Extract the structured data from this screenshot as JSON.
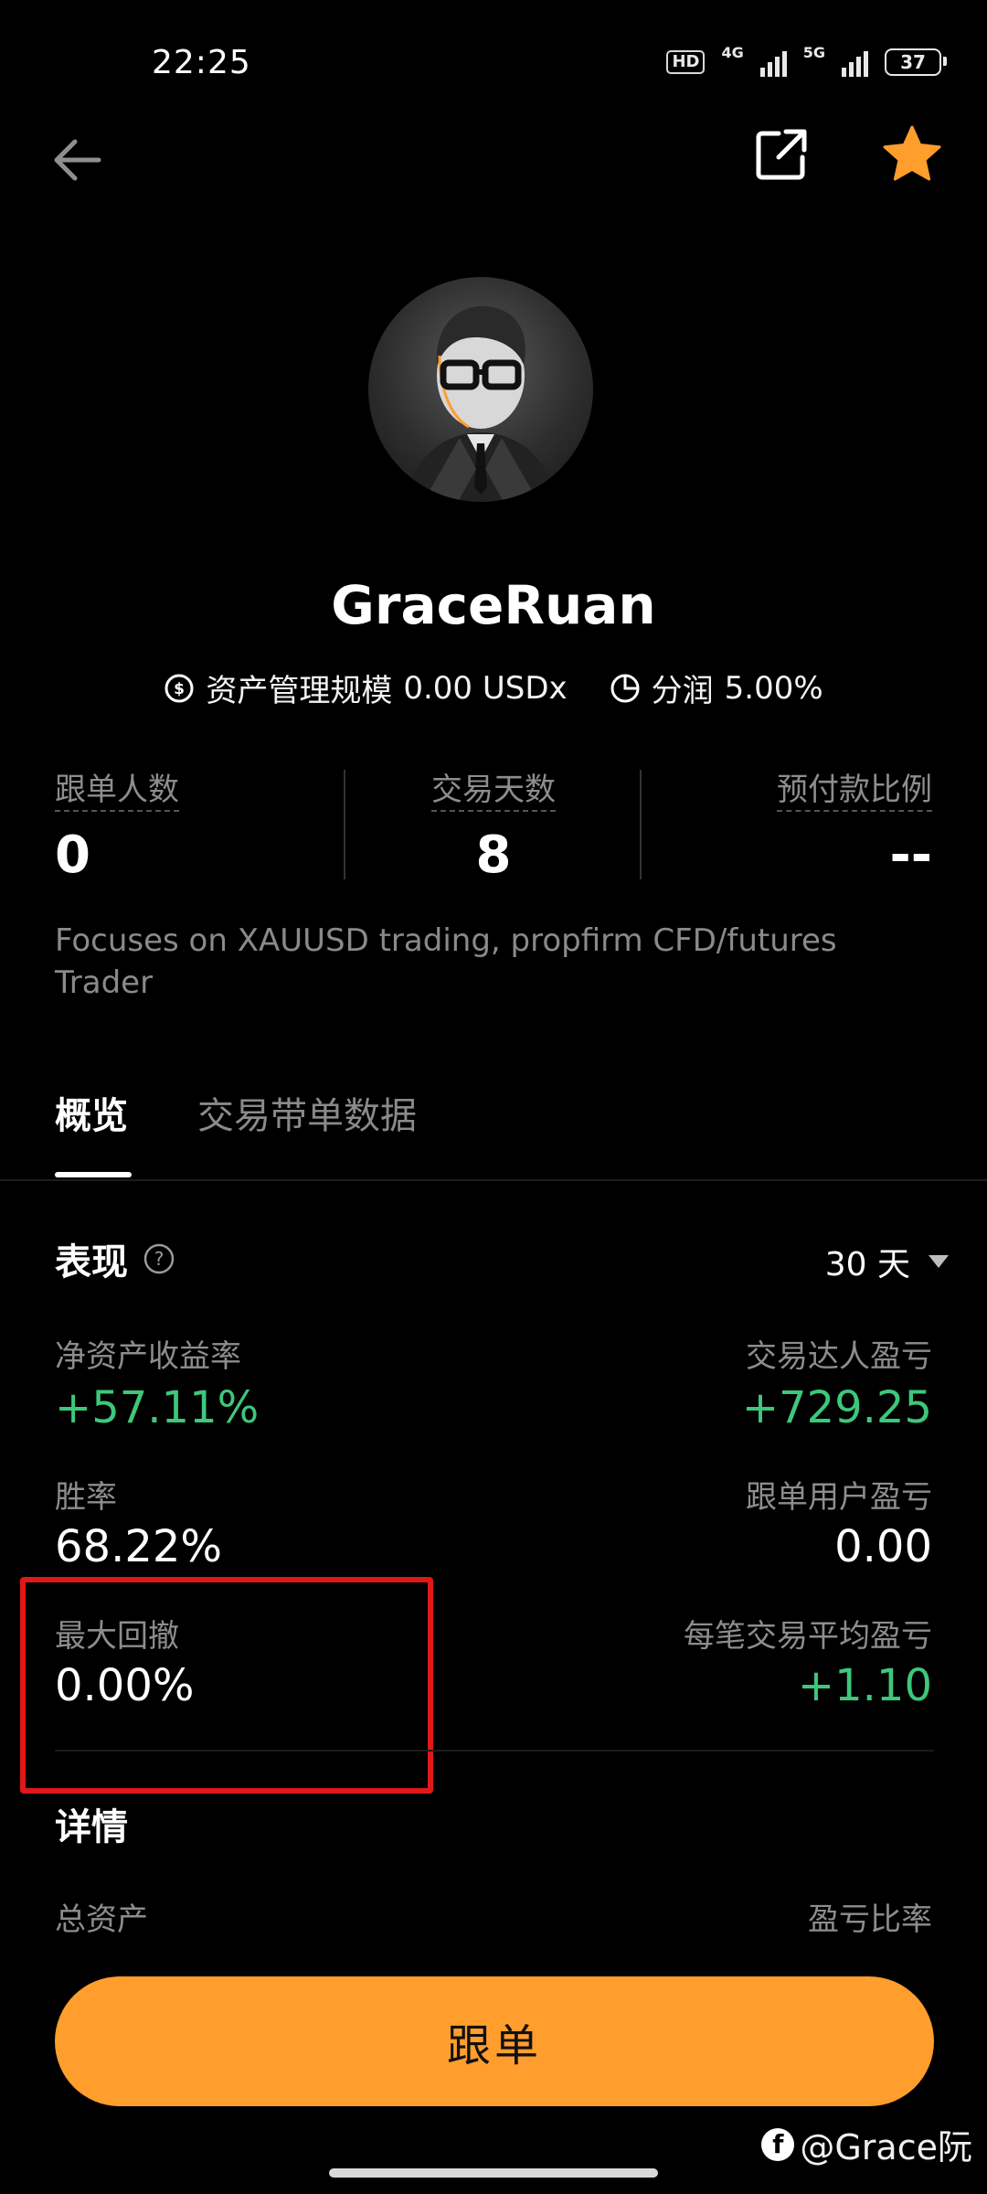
{
  "status_bar": {
    "time": "22:25",
    "network_hd": "HD",
    "net_1": "4G",
    "net_2": "5G",
    "battery": "37"
  },
  "profile": {
    "name": "GraceRuan",
    "aum_label": "资产管理规模",
    "aum_value": "0.00 USDx",
    "profit_share_label": "分润",
    "profit_share_value": "5.00%"
  },
  "stats": [
    {
      "label": "跟单人数",
      "value": "0"
    },
    {
      "label": "交易天数",
      "value": "8"
    },
    {
      "label": "预付款比例",
      "value": "--"
    }
  ],
  "description": "Focuses on XAUUSD trading, propfirm CFD/futures Trader",
  "tabs": [
    {
      "label": "概览",
      "active": true
    },
    {
      "label": "交易带单数据",
      "active": false
    }
  ],
  "performance": {
    "title": "表现",
    "period": "30 天",
    "metrics": [
      {
        "label": "净资产收益率",
        "value": "+57.11%",
        "color": "#3ec77b"
      },
      {
        "label": "交易达人盈亏",
        "value": "+729.25",
        "color": "#3ec77b"
      },
      {
        "label": "胜率",
        "value": "68.22%",
        "color": "#ffffff"
      },
      {
        "label": "跟单用户盈亏",
        "value": "0.00",
        "color": "#ffffff"
      },
      {
        "label": "最大回撤",
        "value": "0.00%",
        "color": "#ffffff"
      },
      {
        "label": "每笔交易平均盈亏",
        "value": "+1.10",
        "color": "#3ec77b"
      }
    ]
  },
  "details": {
    "title": "详情",
    "left_label": "总资产",
    "right_label": "盈亏比率"
  },
  "follow_button": "跟单",
  "watermark": "@Grace阮",
  "colors": {
    "accent": "#ff9d2d",
    "positive": "#3ec77b",
    "highlight": "#e01818"
  }
}
